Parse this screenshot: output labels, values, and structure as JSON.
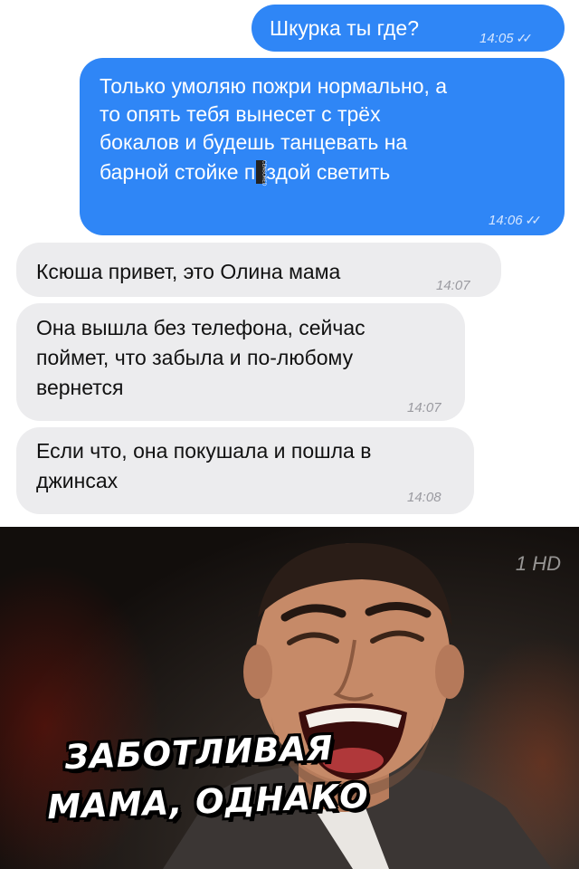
{
  "messages": [
    {
      "side": "out",
      "lines": [
        "Шкурка ты где?"
      ],
      "time": "14:05"
    },
    {
      "side": "out",
      "lines": [
        "Только умоляю пожри нормально, а",
        "то опять тебя вынесет с трёх",
        "бокалов и будешь танцевать на"
      ],
      "line4_before": "барной стойке п",
      "censor_label": "CENSORED",
      "line4_after": "здой светить",
      "time": "14:06"
    },
    {
      "side": "in",
      "lines": [
        "Ксюша привет, это Олина мама"
      ],
      "time": "14:07"
    },
    {
      "side": "in",
      "lines": [
        "Она вышла без телефона, сейчас",
        "поймет, что забыла и по-любому",
        "вернется"
      ],
      "time": "14:07"
    },
    {
      "side": "in",
      "lines": [
        "Если что, она покушала и пошла в",
        "джинсах"
      ],
      "time": "14:08"
    }
  ],
  "meme": {
    "caption_line1": "ЗАБОТЛИВАЯ",
    "caption_line2": "МАМА, ОДНАКО",
    "channel_logo": "1 HD"
  },
  "colors": {
    "outgoing": "#2f86f6",
    "incoming": "#ececee"
  }
}
